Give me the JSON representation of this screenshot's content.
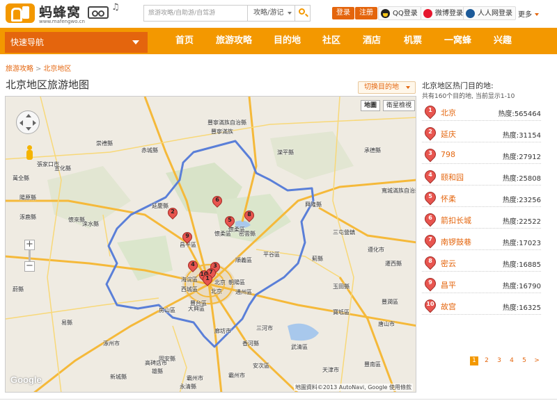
{
  "header": {
    "logo_text": "蚂蜂窝",
    "logo_sub": "www.mafengwo.cn",
    "search": {
      "placeholder": "旅游攻略/自助游/自驾游",
      "type": "攻略/游记"
    },
    "login_label": "登录",
    "register_label": "注册",
    "qq_label": "QQ登录",
    "weibo_label": "微博登录",
    "renren_label": "人人网登录",
    "more_label": "更多"
  },
  "nav": {
    "quick_nav": "快速导航",
    "items": [
      "首页",
      "旅游攻略",
      "目的地",
      "社区",
      "酒店",
      "机票",
      "一窝蜂",
      "兴趣"
    ]
  },
  "breadcrumb": [
    "旅游攻略",
    "北京地区"
  ],
  "page_title": "北京地区旅游地图",
  "switch_label": "切换目的地",
  "map": {
    "type_buttons": [
      "地圖",
      "衛星檢視"
    ],
    "logo": "Google",
    "attribution": "地圖資料©2013 AutoNavi, Google 使用條款",
    "zoom_in": "+",
    "zoom_out": "−",
    "labels": [
      "豐寧滿族自治縣",
      "崇禮縣",
      "赤城縣",
      "張家口市",
      "萬全縣",
      "延慶縣",
      "懷柔區",
      "密雲縣",
      "昌平區",
      "順義區",
      "平谷區",
      "海淀區",
      "西城區",
      "北京",
      "朝陽區",
      "通州區",
      "豐台區",
      "房山區",
      "大興區",
      "廊坊市",
      "三河市",
      "香河縣",
      "涿州市",
      "固安縣",
      "高碑店市",
      "霸州市",
      "永清縣",
      "遵化市",
      "玉田縣",
      "三屯營鎮",
      "灤平縣",
      "承德縣",
      "興隆縣",
      "寬城滿族自治縣",
      "遷西縣",
      "薊縣",
      "寶坻區",
      "豐潤區",
      "唐山市",
      "天津市",
      "涿鹿縣",
      "懷來縣",
      "宣化縣",
      "陽原縣",
      "蔚縣",
      "涞水縣",
      "易縣",
      "武清區",
      "霸州市",
      "新城縣",
      "安次區",
      "雄縣",
      "豐南區",
      "懷柔區",
      "北京",
      "豐寧滿族"
    ]
  },
  "sidebar": {
    "title": "北京地区热门目的地:",
    "subtitle": "共有160个目的地, 当前显示1-10",
    "heat_label": "热度:",
    "destinations": [
      {
        "rank": "1",
        "name": "北京",
        "heat": "565464"
      },
      {
        "rank": "2",
        "name": "延庆",
        "heat": "31154"
      },
      {
        "rank": "3",
        "name": "798",
        "heat": "27912"
      },
      {
        "rank": "4",
        "name": "颐和园",
        "heat": "25808"
      },
      {
        "rank": "5",
        "name": "怀柔",
        "heat": "23256"
      },
      {
        "rank": "6",
        "name": "箭扣长城",
        "heat": "22522"
      },
      {
        "rank": "7",
        "name": "南锣鼓巷",
        "heat": "17023"
      },
      {
        "rank": "8",
        "name": "密云",
        "heat": "16885"
      },
      {
        "rank": "9",
        "name": "昌平",
        "heat": "16790"
      },
      {
        "rank": "10",
        "name": "故宫",
        "heat": "16325"
      }
    ],
    "pages": [
      "1",
      "2",
      "3",
      "4",
      "5",
      ">"
    ]
  },
  "colors": {
    "accent": "#f39800",
    "accent_dark": "#e4650d",
    "marker": "#e8554f",
    "boundary": "#5a7fd8"
  }
}
